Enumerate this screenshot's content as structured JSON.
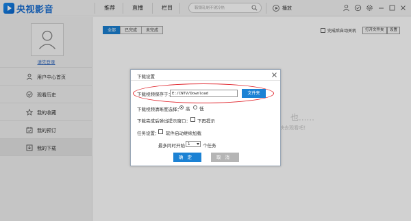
{
  "app": {
    "logo_text": "央视影音"
  },
  "nav": {
    "items": [
      "推荐",
      "直播",
      "栏目"
    ]
  },
  "search": {
    "placeholder": "鞍钢轧制不锈冷热"
  },
  "play": {
    "label": "播放"
  },
  "sidebar": {
    "login": "请先登录",
    "items": [
      {
        "label": "用户中心首页",
        "icon": "user-icon"
      },
      {
        "label": "观看历史",
        "icon": "history-icon"
      },
      {
        "label": "我的收藏",
        "icon": "star-icon"
      },
      {
        "label": "我的预订",
        "icon": "calendar-icon"
      },
      {
        "label": "我的下载",
        "icon": "download-icon"
      }
    ],
    "active_index": 4
  },
  "content": {
    "tabs": [
      "全部",
      "已完成",
      "未完成"
    ],
    "active_tab": 0,
    "auto_shutdown": "完成后自动关机",
    "open_folder": "打开文件夹",
    "settings": "设置",
    "empty_title": "也......",
    "empty_sub": "快去观看吧！"
  },
  "dialog": {
    "title": "下载设置",
    "save_label": "下载视频保存于：",
    "save_path": "E:/CNTV/Download",
    "folder_button": "文件夹",
    "quality_label": "下载视频清晰度选择：",
    "quality_high": "高",
    "quality_low": "低",
    "quality_selected": "高",
    "popup_label": "下载完成后弹出提示窗口：",
    "no_prompt": "下再提示",
    "task_label": "任务设置：",
    "auto_resume": "软件启动继续加载",
    "concurrent_prefix": "最多同时开始",
    "concurrent_value": "1",
    "concurrent_suffix": "个任务",
    "ok": "确定",
    "cancel": "取消"
  },
  "colors": {
    "accent": "#1c82d4",
    "highlight_ellipse": "#e0262d"
  }
}
